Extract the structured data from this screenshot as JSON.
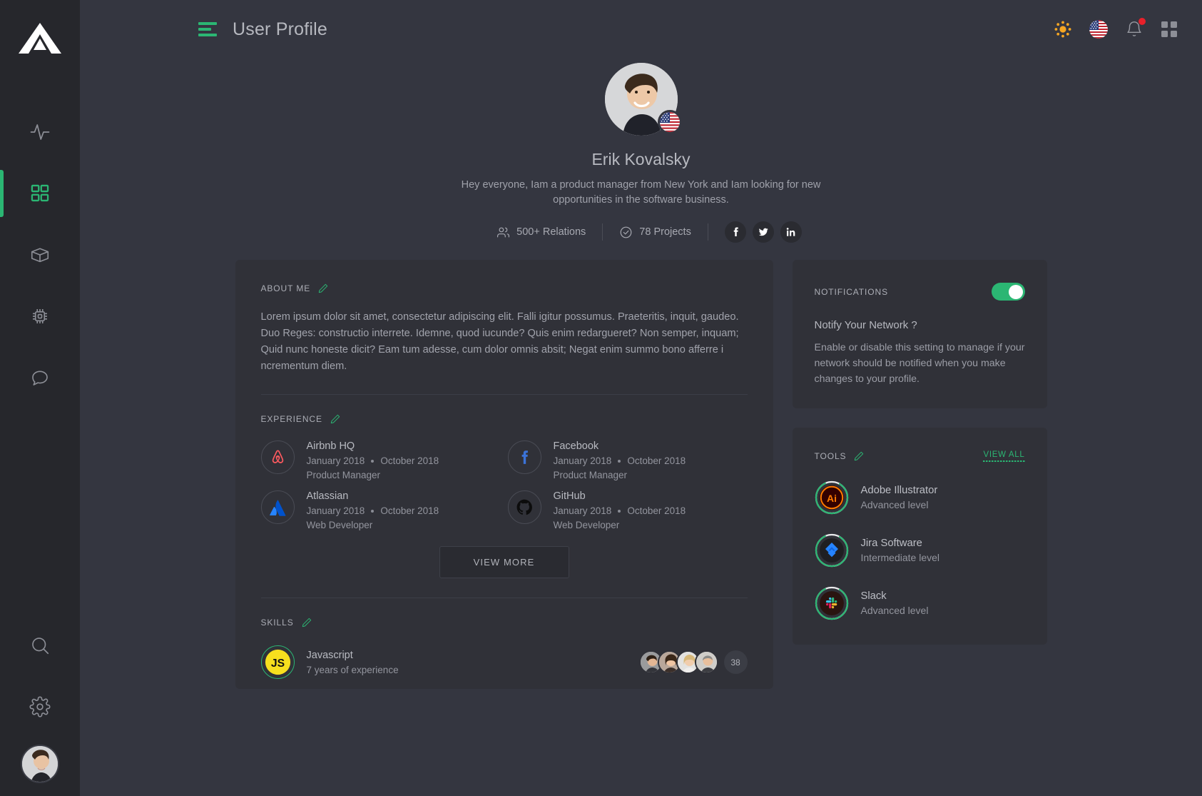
{
  "sidebar": {
    "logo_name": "triangle-logo",
    "items": [
      {
        "icon": "activity-icon",
        "name": "sidebar-item-activity",
        "active": false
      },
      {
        "icon": "grid-icon",
        "name": "sidebar-item-dashboard",
        "active": true
      },
      {
        "icon": "box-icon",
        "name": "sidebar-item-products",
        "active": false
      },
      {
        "icon": "chip-icon",
        "name": "sidebar-item-hardware",
        "active": false
      },
      {
        "icon": "chat-icon",
        "name": "sidebar-item-messages",
        "active": false
      }
    ],
    "bottom_items": [
      {
        "icon": "search-icon",
        "name": "sidebar-item-search"
      },
      {
        "icon": "gear-icon",
        "name": "sidebar-item-settings"
      }
    ],
    "avatar_name": "sidebar-user-avatar"
  },
  "header": {
    "menu_icon": "hamburger-icon",
    "title": "User Profile",
    "actions": [
      {
        "icon": "sun-icon",
        "name": "theme-toggle-button"
      },
      {
        "icon": "flag-us-icon",
        "name": "language-button"
      },
      {
        "icon": "bell-icon",
        "name": "notifications-button",
        "badge": true
      },
      {
        "icon": "apps-grid-icon",
        "name": "apps-button"
      }
    ]
  },
  "profile": {
    "avatar_name": "profile-avatar",
    "flag_name": "profile-flag-us",
    "name": "Erik Kovalsky",
    "bio": "Hey everyone,  Iam a product manager from New York and Iam looking for new opportunities in the software business.",
    "stats": [
      {
        "icon": "people-icon",
        "label": "500+ Relations"
      },
      {
        "icon": "check-circle-icon",
        "label": "78 Projects"
      }
    ],
    "socials": [
      {
        "icon": "facebook-icon",
        "name": "social-facebook"
      },
      {
        "icon": "twitter-icon",
        "name": "social-twitter"
      },
      {
        "icon": "linkedin-icon",
        "name": "social-linkedin"
      }
    ]
  },
  "about": {
    "title": "ABOUT ME",
    "edit_icon": "pencil-icon",
    "text": "Lorem ipsum dolor sit amet, consectetur adipiscing elit. Falli igitur possumus. Praeteritis, inquit, gaudeo. Duo Reges: constructio interrete. Idemne, quod iucunde? Quis enim redargueret? Non semper, inquam; Quid nunc honeste dicit? Eam tum adesse, cum dolor omnis absit; Negat enim summo bono afferre i ncrementum diem."
  },
  "experience": {
    "title": "EXPERIENCE",
    "edit_icon": "pencil-icon",
    "items": [
      {
        "logo": "airbnb-icon",
        "company": "Airbnb HQ",
        "start": "January 2018",
        "end": "October 2018",
        "role": "Product Manager"
      },
      {
        "logo": "facebook-icon",
        "company": "Facebook",
        "start": "January 2018",
        "end": "October 2018",
        "role": "Product Manager"
      },
      {
        "logo": "atlassian-icon",
        "company": "Atlassian",
        "start": "January 2018",
        "end": "October 2018",
        "role": "Web Developer"
      },
      {
        "logo": "github-icon",
        "company": "GitHub",
        "start": "January 2018",
        "end": "October 2018",
        "role": "Web Developer"
      }
    ],
    "view_more_label": "VIEW MORE"
  },
  "skills": {
    "title": "SKILLS",
    "edit_icon": "pencil-icon",
    "items": [
      {
        "logo": "javascript-icon",
        "name": "Javascript",
        "experience": "7 years of experience",
        "people_count": "38"
      }
    ]
  },
  "notifications": {
    "title": "NOTIFICATIONS",
    "toggle_on": true,
    "question": "Notify Your Network ?",
    "description": "Enable or disable this setting to manage if your network should be notified when you make changes to your profile."
  },
  "tools": {
    "title": "TOOLS",
    "edit_icon": "pencil-icon",
    "view_all_label": "VIEW ALL",
    "items": [
      {
        "logo": "adobe-illustrator-icon",
        "name": "Adobe Illustrator",
        "level": "Advanced level",
        "progress": 85
      },
      {
        "logo": "jira-icon",
        "name": "Jira Software",
        "level": "Intermediate level",
        "progress": 85
      },
      {
        "logo": "slack-icon",
        "name": "Slack",
        "level": "Advanced level",
        "progress": 85
      }
    ]
  },
  "colors": {
    "accent_green": "#2bb673",
    "page_bg": "#343640",
    "sidebar_bg": "#26272c",
    "card_bg": "#303138",
    "notif_red": "#e8202a"
  }
}
